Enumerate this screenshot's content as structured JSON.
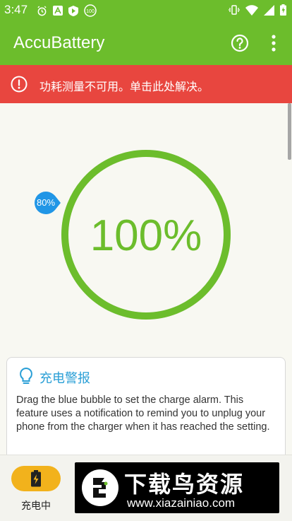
{
  "status_bar": {
    "time": "3:47"
  },
  "app_bar": {
    "title": "AccuBattery"
  },
  "banner": {
    "text": "功耗测量不可用。单击此处解决。"
  },
  "gauge": {
    "percent_text": "100%",
    "charge_level": 1.0,
    "alarm_bubble_text": "80%",
    "alarm_level": 0.8
  },
  "charge_alarm_card": {
    "title": "充电警报",
    "body": "Drag the blue bubble to set the charge alarm. This feature uses a notification to remind you to unplug your phone from the charger when it has reached the setting."
  },
  "bottom_nav": {
    "items": [
      {
        "label": "充电中",
        "icon": "charging-battery-icon",
        "active": true
      }
    ]
  },
  "watermark": {
    "title": "下载鸟资源",
    "url": "www.xiazainiao.com"
  },
  "colors": {
    "accent": "#6cbd2c",
    "error": "#e8463f",
    "link": "#2a9fd6",
    "alarm_bubble": "#2196e6",
    "nav_active": "#f2b21c"
  }
}
